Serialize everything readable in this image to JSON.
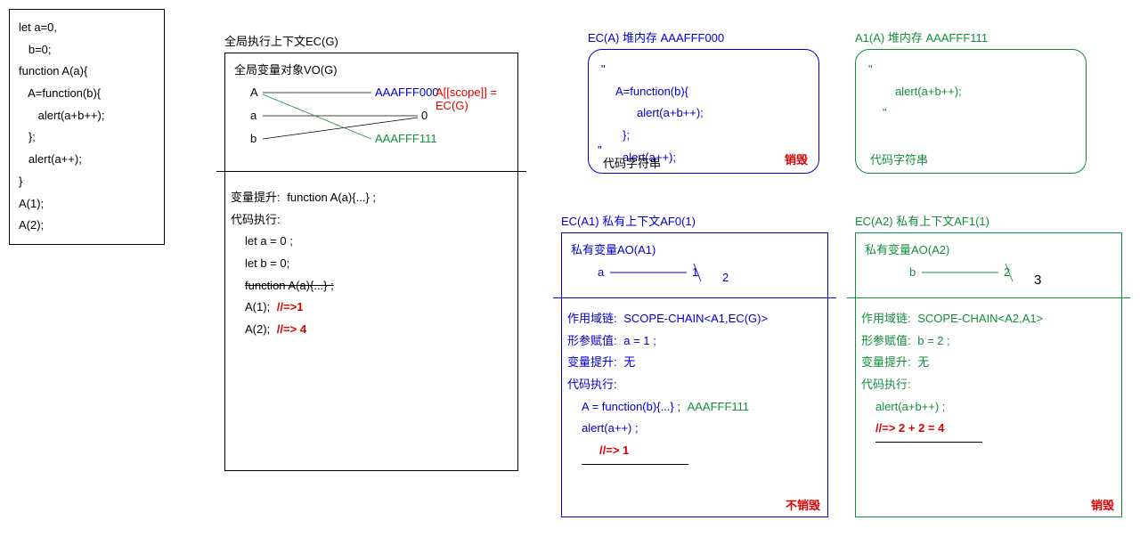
{
  "code_box": {
    "l1": "let a=0,",
    "l2": "   b=0;",
    "l3": "function A(a){",
    "l4": "   A=function(b){",
    "l5": "      alert(a+b++);",
    "l6": "   };",
    "l7": "   alert(a++);",
    "l8": "}",
    "l9": "A(1);",
    "l10": "A(2);"
  },
  "ecg": {
    "title": "全局执行上下文EC(G)",
    "vo_title": "全局变量对象VO(G)",
    "var_A": "A",
    "var_a": "a",
    "var_b": "b",
    "addr_A": "AAAFFF000",
    "scope_note": "A[[scope]] = EC(G)",
    "zero": "0",
    "addr_A1": "AAAFFF111",
    "hoist_label": "变量提升:",
    "hoist_fn": "function A(a){...} ;",
    "exec_label": "代码执行:",
    "let_a": "let a = 0 ;",
    "let_b": "let b = 0;",
    "fn_crossed": "function A(a){...} ;",
    "call_A1": "A(1);",
    "call_A1_res": "//=>1",
    "call_A2": "A(2);",
    "call_A2_res": "//=> 4"
  },
  "heap_A": {
    "title": "EC(A) 堆内存 AAAFFF000",
    "q1": "\"",
    "l1": "A=function(b){",
    "l2": "alert(a+b++);",
    "l3": "};",
    "l4": "alert(a++);",
    "q2": "\"",
    "footer": "代码字符串",
    "destroy": "销毁"
  },
  "heap_A1": {
    "title": "A1(A) 堆内存 AAAFFF111",
    "q1": "\"",
    "l1": "alert(a+b++);",
    "q2": "\"",
    "footer": "代码字符串"
  },
  "ec_a1": {
    "title": "EC(A1) 私有上下文AF0(1)",
    "ao_title": "私有变量AO(A1)",
    "var": "a",
    "v1": "1",
    "v2": "2",
    "scope_label": "作用域链:",
    "scope_val": "SCOPE-CHAIN<A1,EC(G)>",
    "param_label": "形参赋值:",
    "param_val": "a = 1 ;",
    "hoist_label": "变量提升:",
    "hoist_val": "无",
    "exec_label": "代码执行:",
    "exec_l1a": "A = function(b){...} ;",
    "exec_l1b": "AAAFFF111",
    "exec_l2": "alert(a++) ;",
    "exec_res": "//=> 1",
    "footer": "不销毁"
  },
  "ec_a2": {
    "title": "EC(A2) 私有上下文AF1(1)",
    "ao_title": "私有变量AO(A2)",
    "var": "b",
    "v1": "2",
    "v2": "3",
    "scope_label": "作用域链:",
    "scope_val": "SCOPE-CHAIN<A2,A1>",
    "param_label": "形参赋值:",
    "param_val": "b = 2 ;",
    "hoist_label": "变量提升:",
    "hoist_val": "无",
    "exec_label": "代码执行:",
    "exec_l1": "alert(a+b++) ;",
    "exec_res": "//=> 2 + 2 = 4",
    "footer": "销毁"
  }
}
